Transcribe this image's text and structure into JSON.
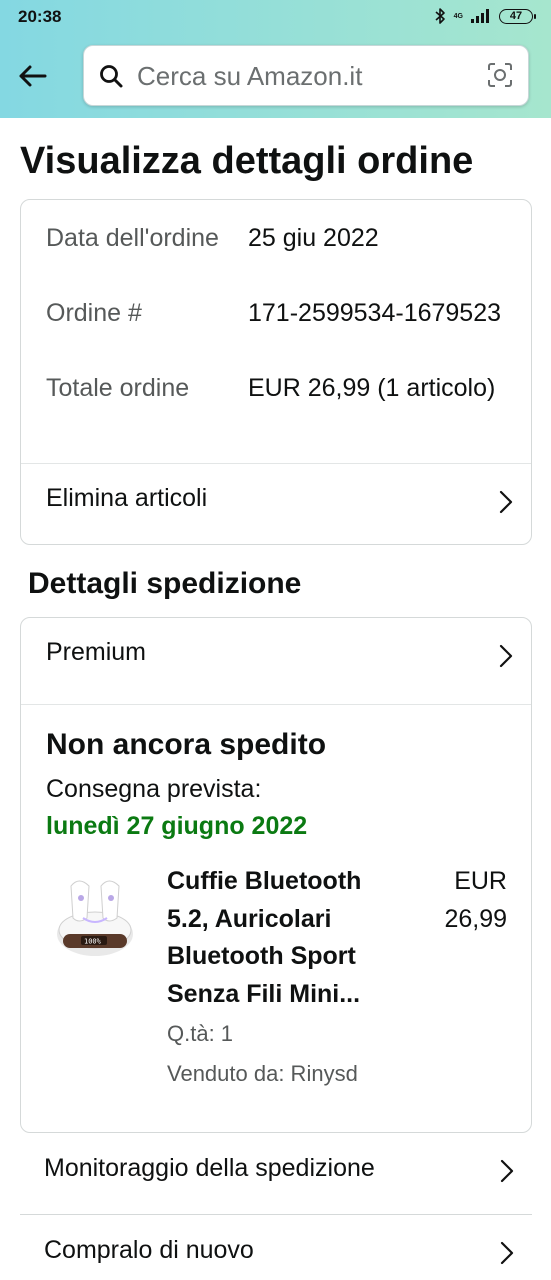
{
  "status_bar": {
    "time": "20:38",
    "network": "4G",
    "battery": "47"
  },
  "search": {
    "placeholder": "Cerca su Amazon.it"
  },
  "page": {
    "title": "Visualizza dettagli ordine"
  },
  "order_summary": {
    "date_label": "Data dell'ordine",
    "date_value": "25 giu 2022",
    "number_label": "Ordine #",
    "number_value": "171-2599534-1679523",
    "total_label": "Totale ordine",
    "total_value": "EUR 26,99 (1 articolo)",
    "delete_items_label": "Elimina articoli"
  },
  "shipping": {
    "section_title": "Dettagli spedizione",
    "shipping_type": "Premium",
    "status": "Non ancora spedito",
    "delivery_label": "Consegna prevista:",
    "delivery_date": "lunedì 27 giugno 2022",
    "delivery_date_color": "#0b7a12",
    "product": {
      "title": "Cuffie Bluetooth 5.2, Auricolari Bluetooth Sport Senza Fili Mini...",
      "price": "EUR 26,99",
      "quantity": "Q.tà: 1",
      "seller": "Venduto da: Rinysd"
    }
  },
  "actions": {
    "track_label": "Monitoraggio della spedizione",
    "buy_again_label": "Compralo di nuovo"
  },
  "icons": [
    "arrow-left-icon",
    "search-icon",
    "camera-icon",
    "chevron-right-icon",
    "bluetooth-icon",
    "signal-icon",
    "battery-icon"
  ],
  "colors": {
    "header_start": "#84d8e2",
    "header_end": "#a6e6ce",
    "text": "#0f1111",
    "secondary_text": "#565959"
  }
}
